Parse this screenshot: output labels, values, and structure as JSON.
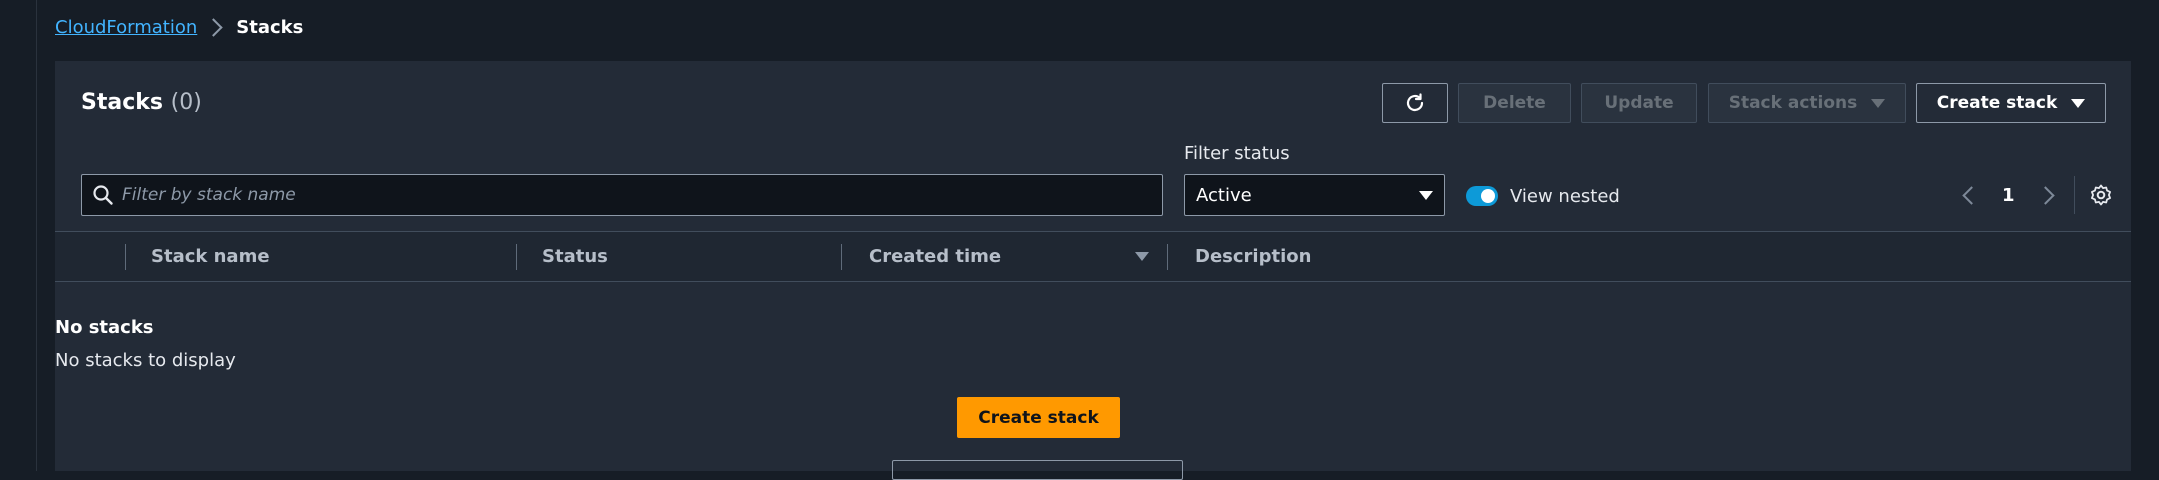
{
  "breadcrumb": {
    "link": "CloudFormation",
    "current": "Stacks"
  },
  "header": {
    "title": "Stacks",
    "count": "(0)"
  },
  "toolbar": {
    "refresh_icon": "refresh-icon",
    "delete_label": "Delete",
    "update_label": "Update",
    "stack_actions_label": "Stack actions",
    "create_stack_label": "Create stack"
  },
  "filters": {
    "search_placeholder": "Filter by stack name",
    "status_label": "Filter status",
    "status_value": "Active",
    "view_nested_label": "View nested",
    "view_nested_on": true
  },
  "pagination": {
    "current_page": "1"
  },
  "table": {
    "columns": [
      "Stack name",
      "Status",
      "Created time",
      "Description"
    ]
  },
  "empty_state": {
    "title": "No stacks",
    "subtitle": "No stacks to display",
    "create_label": "Create stack"
  },
  "colors": {
    "accent": "#0d9ad8",
    "primary_button": "#ff9900",
    "link": "#42b4ff"
  }
}
